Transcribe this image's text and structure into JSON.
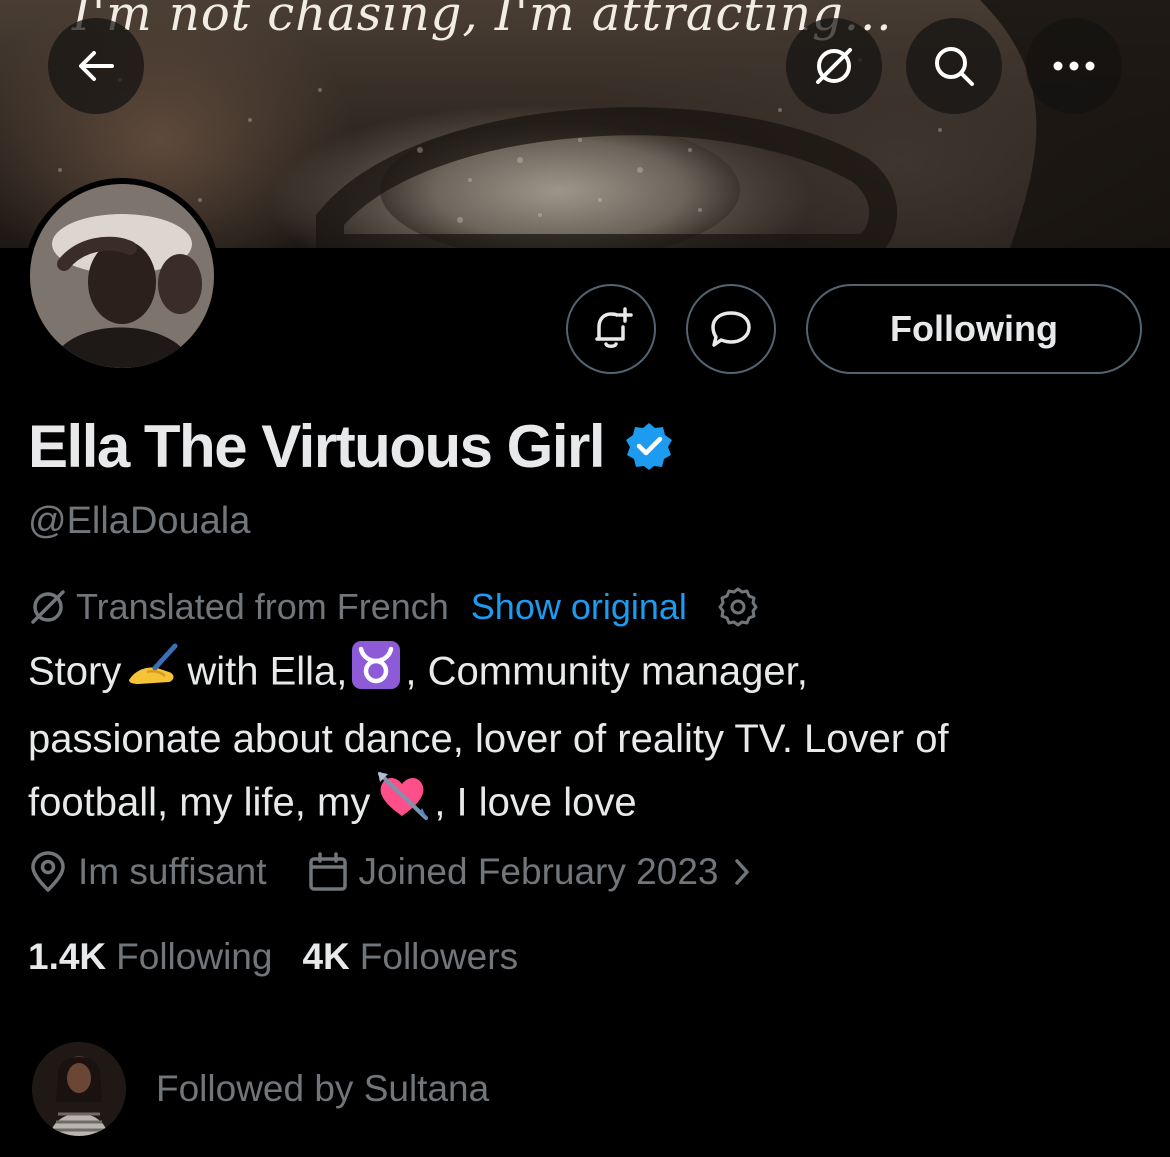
{
  "banner": {
    "quote": "I'm not chasing, I'm attracting..."
  },
  "topbar": {
    "back_icon": "arrow-left-icon",
    "translate_icon": "translate-icon",
    "search_icon": "search-icon",
    "more_icon": "more-horizontal-icon"
  },
  "profile_actions": {
    "notify_icon": "bell-plus-icon",
    "message_icon": "message-bubble-icon",
    "following_label": "Following"
  },
  "profile": {
    "display_name": "Ella The Virtuous Girl",
    "handle": "@EllaDouala",
    "verified_color": "#1d9bf0"
  },
  "translation": {
    "label": "Translated from French",
    "show_original": "Show original",
    "accent_color": "#1d9bf0"
  },
  "bio": {
    "line1_a": "Story",
    "line1_b": "with Ella,",
    "line1_c": ", Community manager,",
    "line2": "passionate about dance, lover of reality TV. Lover of",
    "line3_a": "football, my life, my",
    "line3_b": ", I love love",
    "emoji_1": "writing-hand-emoji",
    "emoji_2": "taurus-emoji",
    "emoji_3": "heart-with-arrow-emoji"
  },
  "meta": {
    "location": "Im suffisant",
    "joined": "Joined February 2023"
  },
  "stats": {
    "following_count": "1.4K",
    "following_label": "Following",
    "followers_count": "4K",
    "followers_label": "Followers"
  },
  "followed_by": {
    "text": "Followed by Sultana"
  }
}
